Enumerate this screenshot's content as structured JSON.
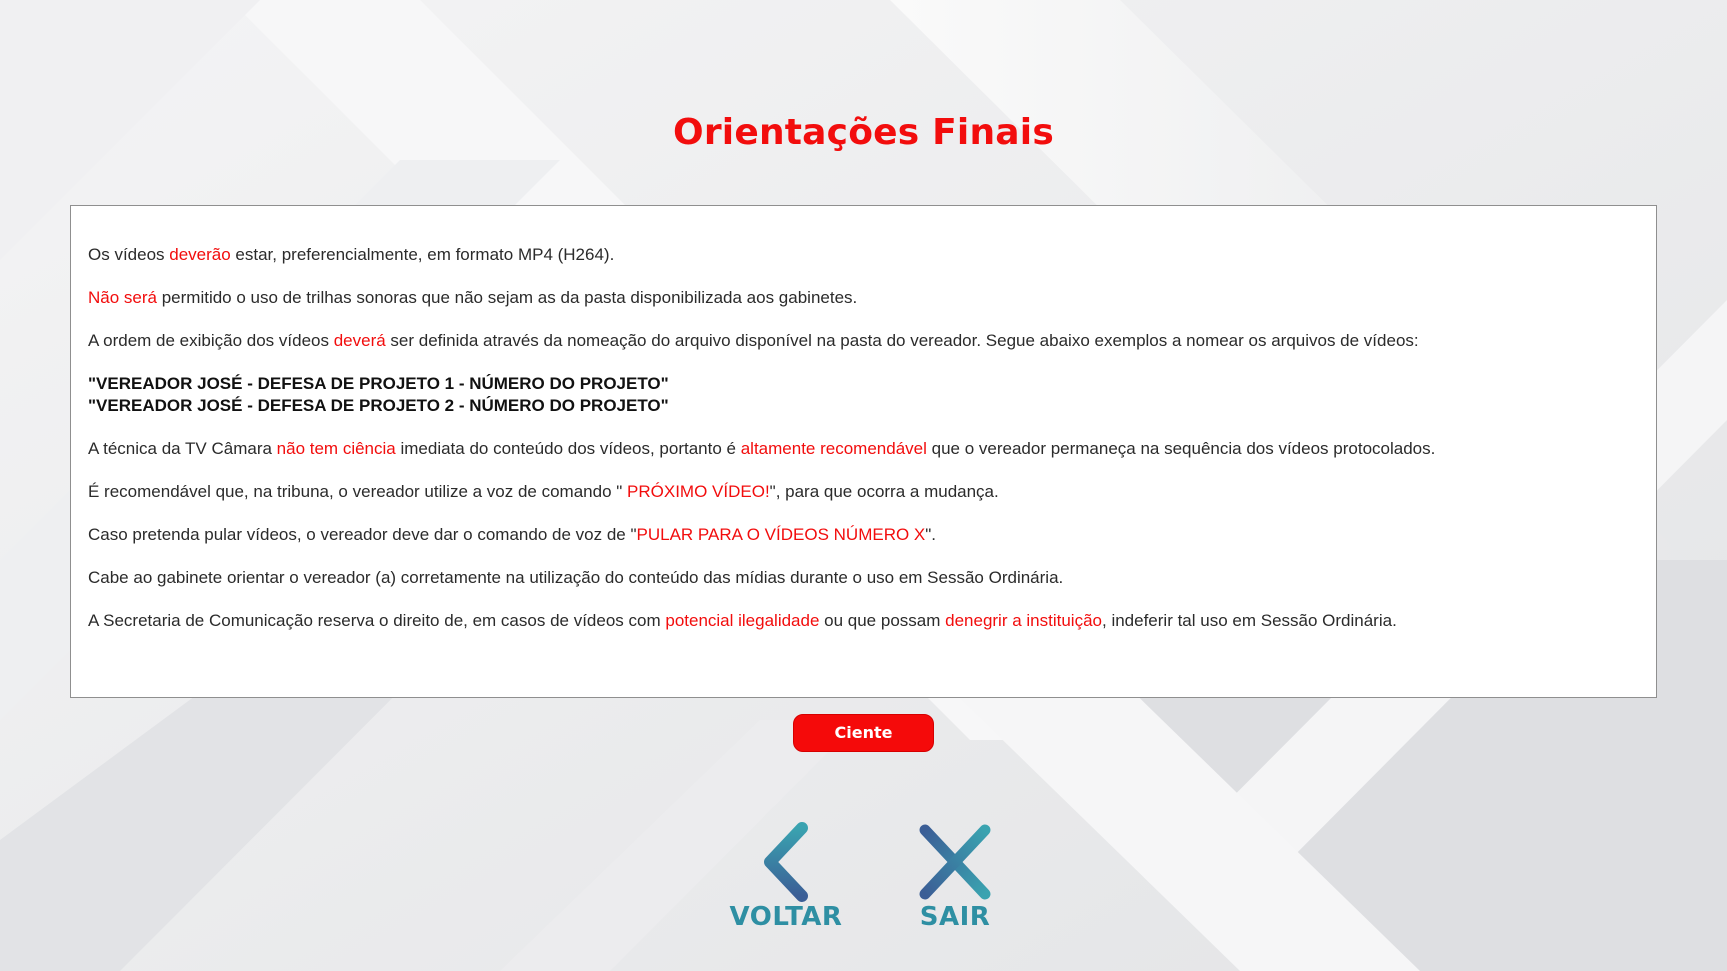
{
  "title": "Orientações Finais",
  "colors": {
    "accent": "#f20d0d",
    "text": "#2b2b2b",
    "nav": "#2e8fa3",
    "background": "#e9eaec"
  },
  "content": {
    "p1": {
      "a": "Os vídeos ",
      "b": "deverão",
      "c": " estar, preferencialmente, em formato MP4 (H264)."
    },
    "p2": {
      "a": "Não será",
      "b": " permitido o uso de trilhas sonoras que não sejam as da pasta disponibilizada aos gabinetes."
    },
    "p3": {
      "a": "A ordem de exibição dos vídeos ",
      "b": "deverá",
      "c": " ser definida através da nomeação do arquivo disponível na pasta do vereador. Segue abaixo exemplos a nomear os arquivos de vídeos:"
    },
    "examples": [
      "\"VEREADOR JOSÉ - DEFESA DE PROJETO 1 - NÚMERO DO PROJETO\"",
      "\"VEREADOR JOSÉ - DEFESA DE PROJETO 2 - NÚMERO DO PROJETO\""
    ],
    "p4": {
      "a": "A técnica da TV Câmara ",
      "b": "não tem ciência",
      "c": " imediata do conteúdo dos vídeos, portanto é ",
      "d": "altamente recomendável",
      "e": " que o vereador permaneça na sequência dos vídeos protocolados."
    },
    "p5": {
      "a": "É recomendável que, na tribuna, o vereador utilize a voz de comando \" ",
      "b": "PRÓXIMO VÍDEO!",
      "c": "\", para que ocorra a mudança."
    },
    "p6": {
      "a": "Caso pretenda pular vídeos, o vereador deve dar o comando de voz de \"",
      "b": "PULAR PARA O VÍDEOS NÚMERO X",
      "c": "\"."
    },
    "p7": {
      "a": "Cabe ao gabinete orientar o vereador (a) corretamente na utilização do conteúdo das mídias durante o uso em Sessão Ordinária."
    },
    "p8": {
      "a": "A Secretaria de Comunicação reserva o direito de, em casos de vídeos com ",
      "b": "potencial ilegalidade",
      "c": " ou que possam ",
      "d": "denegrir a instituição",
      "e": ", indeferir tal uso em Sessão Ordinária."
    }
  },
  "buttons": {
    "ciente": "Ciente",
    "voltar": "VOLTAR",
    "sair": "SAIR"
  },
  "icons": {
    "voltar": "chevron-left-icon",
    "sair": "close-icon"
  }
}
